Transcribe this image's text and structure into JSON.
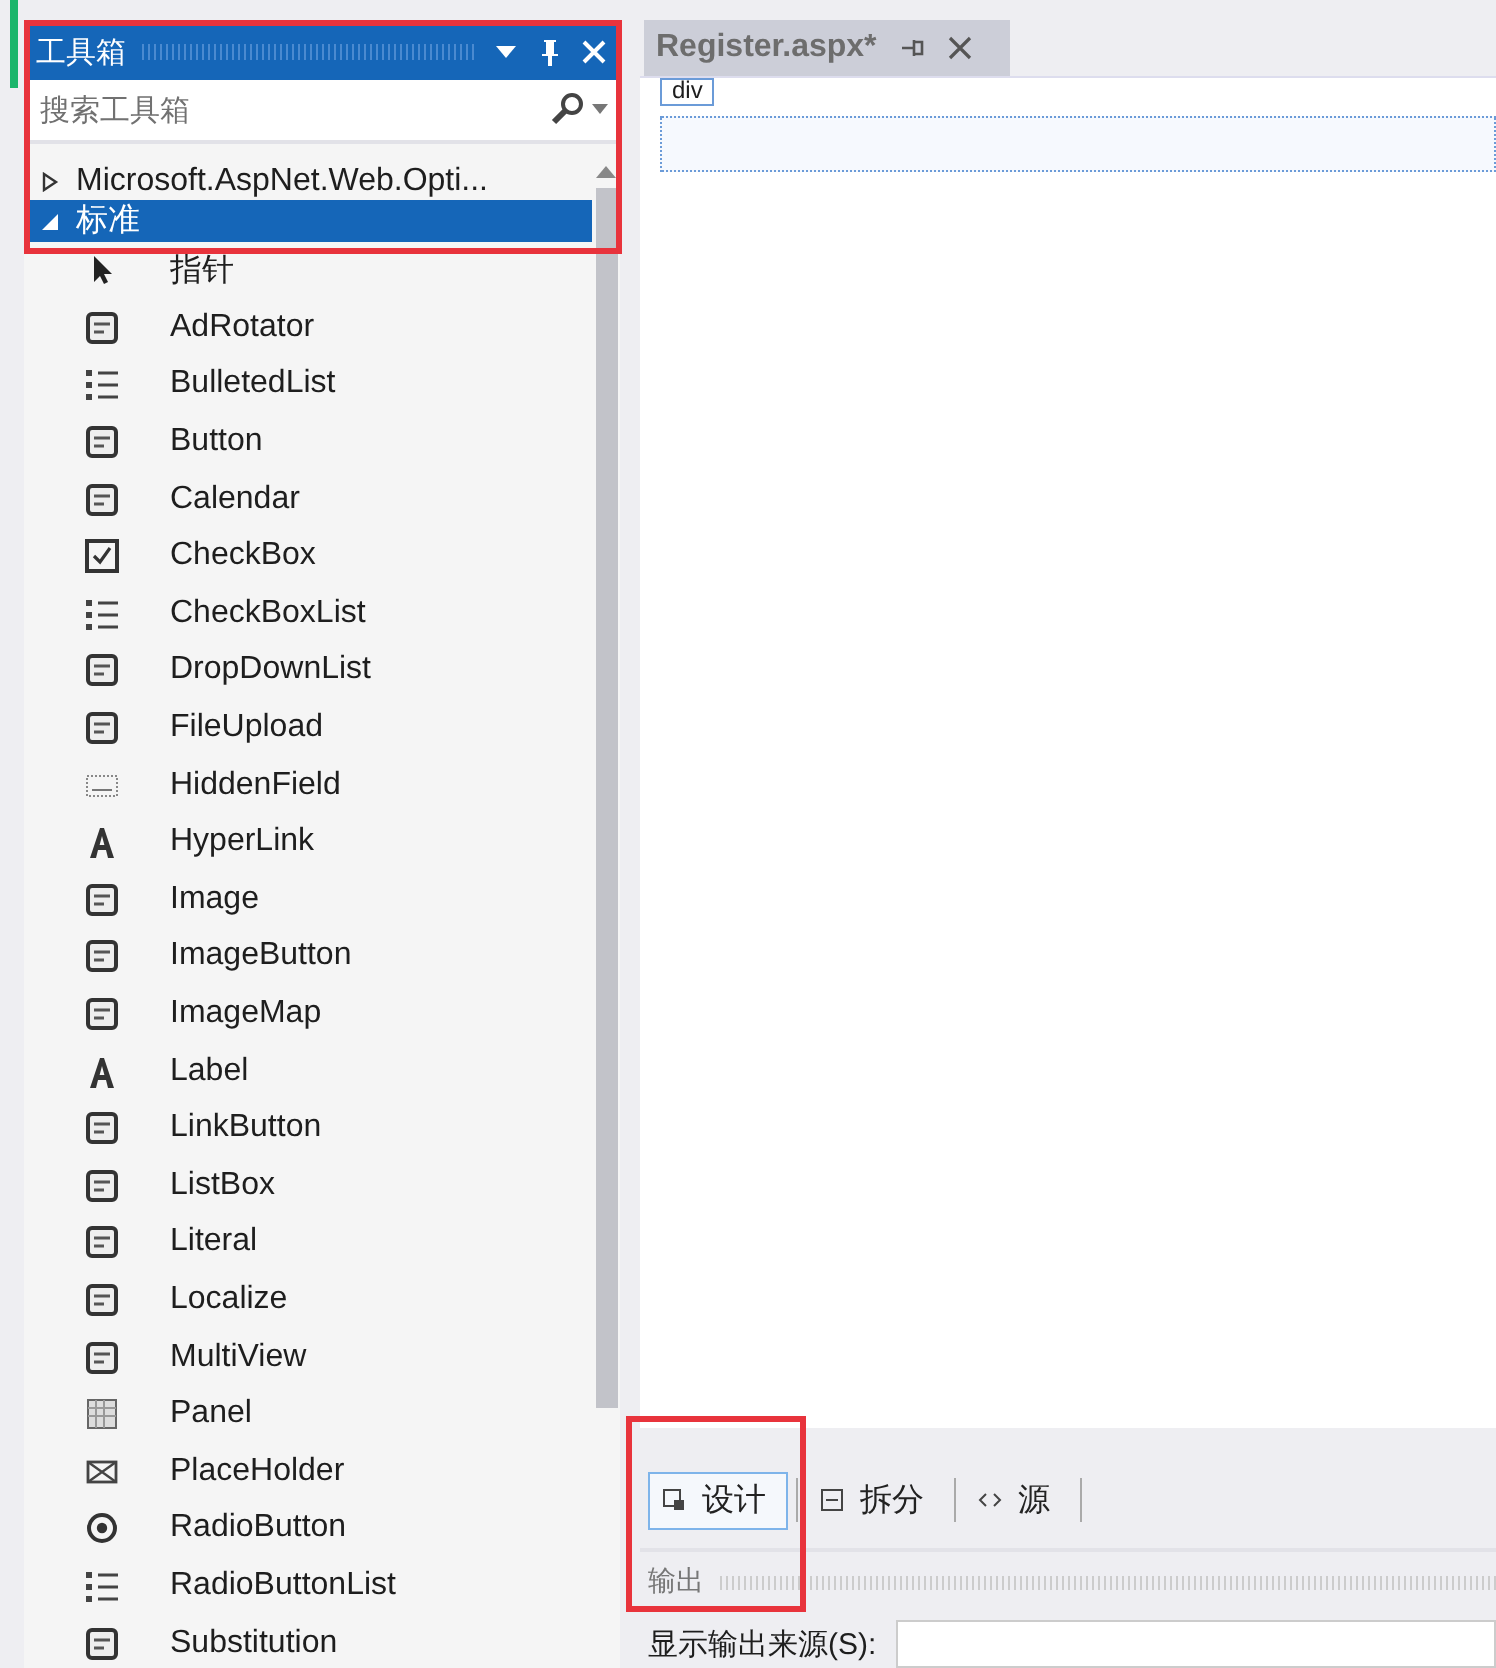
{
  "toolbox": {
    "title": "工具箱",
    "search": {
      "placeholder": "搜索工具箱"
    },
    "groups": [
      {
        "label": "Microsoft.AspNet.Web.Opti...",
        "expanded": false,
        "selected": false
      },
      {
        "label": "标准",
        "expanded": true,
        "selected": true
      }
    ],
    "items": [
      "指针",
      "AdRotator",
      "BulletedList",
      "Button",
      "Calendar",
      "CheckBox",
      "CheckBoxList",
      "DropDownList",
      "FileUpload",
      "HiddenField",
      "HyperLink",
      "Image",
      "ImageButton",
      "ImageMap",
      "Label",
      "LinkButton",
      "ListBox",
      "Literal",
      "Localize",
      "MultiView",
      "Panel",
      "PlaceHolder",
      "RadioButton",
      "RadioButtonList",
      "Substitution"
    ]
  },
  "editor": {
    "tab": {
      "title": "Register.aspx*"
    },
    "element_tag": "div",
    "views": [
      {
        "label": "设计",
        "selected": true
      },
      {
        "label": "拆分",
        "selected": false
      },
      {
        "label": "源",
        "selected": false
      }
    ]
  },
  "output": {
    "title": "输出",
    "source_label": "显示输出来源(S):"
  }
}
